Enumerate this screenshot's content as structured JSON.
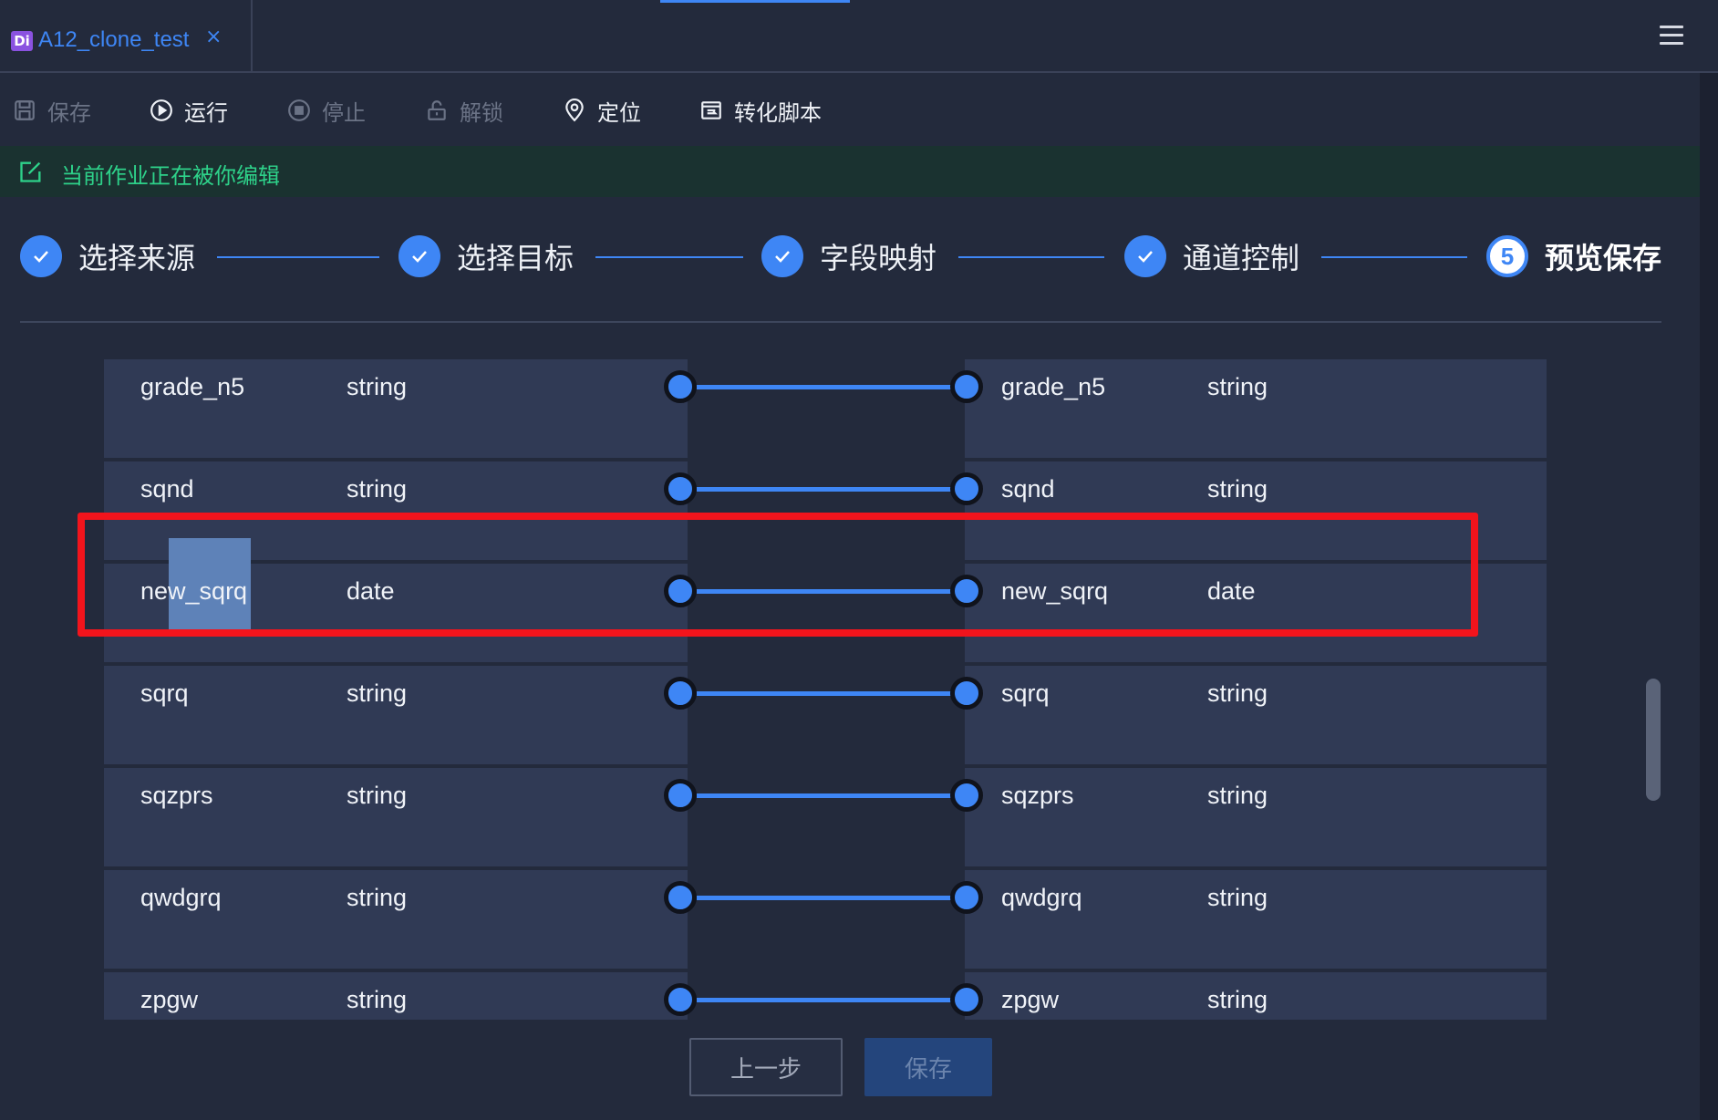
{
  "tab": {
    "logo": "Di",
    "title": "A12_clone_test",
    "close_icon": "×"
  },
  "toolbar": {
    "items": [
      {
        "label": "保存",
        "icon": "save-icon",
        "enabled": false
      },
      {
        "label": "运行",
        "icon": "play-icon",
        "enabled": true
      },
      {
        "label": "停止",
        "icon": "stop-icon",
        "enabled": false
      },
      {
        "label": "解锁",
        "icon": "unlock-icon",
        "enabled": false
      },
      {
        "label": "定位",
        "icon": "location-pin-icon",
        "enabled": true
      },
      {
        "label": "转化脚本",
        "icon": "script-icon",
        "enabled": true
      }
    ]
  },
  "banner": {
    "text": "当前作业正在被你编辑",
    "color": "#2ed28a"
  },
  "stepper": {
    "steps": [
      {
        "label": "选择来源",
        "status": "done"
      },
      {
        "label": "选择目标",
        "status": "done"
      },
      {
        "label": "字段映射",
        "status": "done"
      },
      {
        "label": "通道控制",
        "status": "done"
      },
      {
        "label": "预览保存",
        "status": "current",
        "number": "5"
      }
    ]
  },
  "mapping": {
    "rows": [
      {
        "src_name": "grade_n5",
        "src_type": "string",
        "tgt_name": "grade_n5",
        "tgt_type": "string"
      },
      {
        "src_name": "sqnd",
        "src_type": "string",
        "tgt_name": "sqnd",
        "tgt_type": "string"
      },
      {
        "src_name": "new_sqrq",
        "src_type": "date",
        "tgt_name": "new_sqrq",
        "tgt_type": "date",
        "highlighted": true
      },
      {
        "src_name": "sqrq",
        "src_type": "string",
        "tgt_name": "sqrq",
        "tgt_type": "string"
      },
      {
        "src_name": "sqzprs",
        "src_type": "string",
        "tgt_name": "sqzprs",
        "tgt_type": "string"
      },
      {
        "src_name": "qwdgrq",
        "src_type": "string",
        "tgt_name": "qwdgrq",
        "tgt_type": "string"
      },
      {
        "src_name": "zpgw",
        "src_type": "string",
        "tgt_name": "zpgw",
        "tgt_type": "string"
      }
    ]
  },
  "footer": {
    "prev_label": "上一步",
    "save_label": "保存"
  },
  "colors": {
    "accent": "#3e86f5",
    "highlight_box": "#f2141c",
    "background": "#232a3c"
  }
}
